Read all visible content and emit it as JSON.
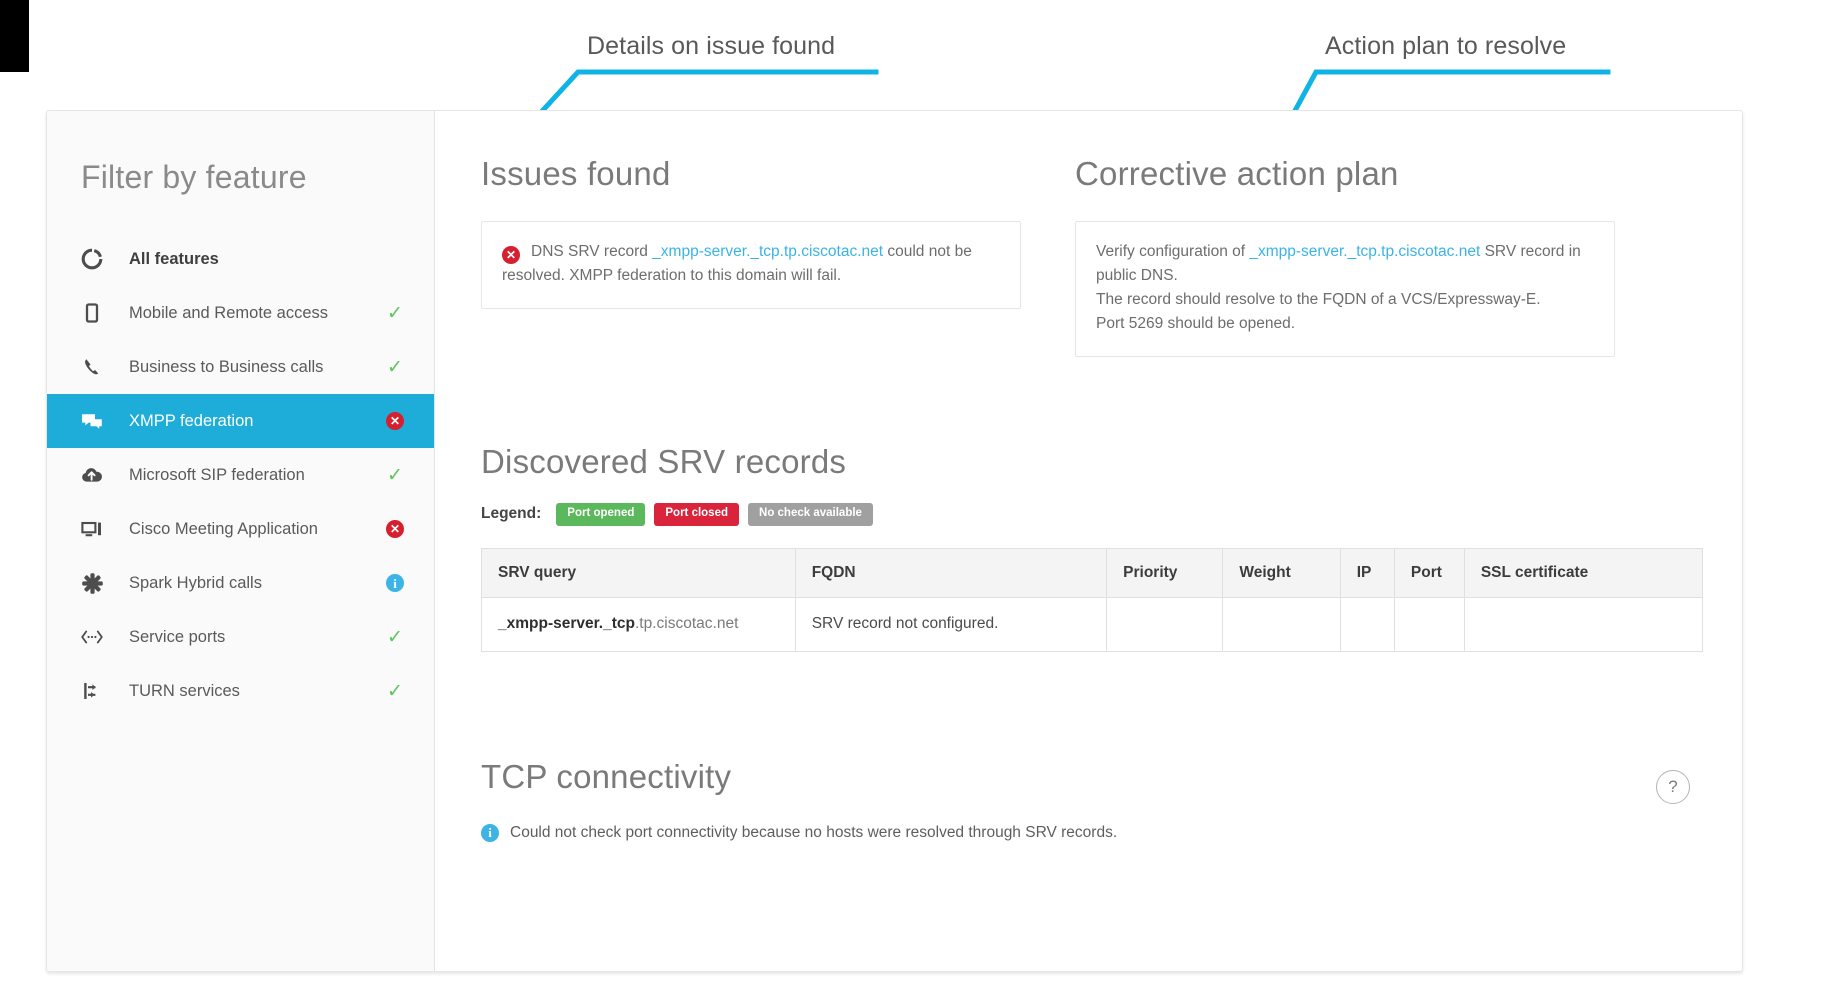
{
  "annotations": {
    "left": {
      "text": "Details on issue found"
    },
    "right": {
      "text": "Action plan to resolve"
    },
    "line_color": "#0fb4e5"
  },
  "colors": {
    "accent": "#1eadd8",
    "link": "#3bb4e5",
    "error": "#d6202f",
    "error_text": "#e8515f",
    "success": "#5ec45e",
    "info": "#3db4e5",
    "legend_green": "#5cb85c",
    "legend_red": "#d9243c",
    "legend_gray": "#a0a0a0"
  },
  "sidebar": {
    "title": "Filter by feature",
    "items": [
      {
        "label": "All features",
        "icon": "all-features-icon",
        "status": "none",
        "bold": true,
        "active": false
      },
      {
        "label": "Mobile and Remote access",
        "icon": "mobile-device-icon",
        "status": "check",
        "bold": false,
        "active": false
      },
      {
        "label": "Business to Business calls",
        "icon": "phone-handset-icon",
        "status": "check",
        "bold": false,
        "active": false
      },
      {
        "label": "XMPP federation",
        "icon": "chat-bubbles-icon",
        "status": "error",
        "bold": false,
        "active": true
      },
      {
        "label": "Microsoft SIP federation",
        "icon": "cloud-upload-icon",
        "status": "check",
        "bold": false,
        "active": false
      },
      {
        "label": "Cisco Meeting Application",
        "icon": "monitor-icon",
        "status": "error",
        "bold": false,
        "active": false
      },
      {
        "label": "Spark Hybrid calls",
        "icon": "spark-asterisk-icon",
        "status": "info",
        "bold": false,
        "active": false
      },
      {
        "label": "Service ports",
        "icon": "service-ports-icon",
        "status": "check",
        "bold": false,
        "active": false
      },
      {
        "label": "TURN services",
        "icon": "turn-services-icon",
        "status": "check",
        "bold": false,
        "active": false
      }
    ],
    "status_glyphs": {
      "check": "✓",
      "error": "✕",
      "info": "i"
    }
  },
  "issues": {
    "heading": "Issues found",
    "item": {
      "icon": "error-badge-icon",
      "text_before": "DNS SRV record ",
      "link": "_xmpp-server._tcp.tp.ciscotac.net",
      "text_after": " could not be resolved. XMPP federation to this domain will fail."
    }
  },
  "corrective": {
    "heading": "Corrective action plan",
    "text_before": "Verify configuration of ",
    "link": "_xmpp-server._tcp.tp.ciscotac.net",
    "text_after": " SRV record in public DNS.",
    "line2": "The record should resolve to the FQDN of a VCS/Expressway-E.",
    "line3": "Port 5269 should be opened."
  },
  "srv": {
    "heading": "Discovered SRV records",
    "legend_label": "Legend:",
    "legend": [
      {
        "label": "Port opened",
        "variant": "green"
      },
      {
        "label": "Port closed",
        "variant": "red"
      },
      {
        "label": "No check available",
        "variant": "gray"
      }
    ],
    "columns": [
      "SRV query",
      "FQDN",
      "Priority",
      "Weight",
      "IP",
      "Port",
      "SSL certificate"
    ],
    "rows": [
      {
        "query_bold": "_xmpp-server._tcp",
        "query_dim": ".tp.ciscotac.net",
        "fqdn": "SRV record not configured.",
        "priority": "",
        "weight": "",
        "ip": "",
        "port": "",
        "ssl": ""
      }
    ]
  },
  "tcp": {
    "heading": "TCP connectivity",
    "note": "Could not check port connectivity because no hosts were resolved through SRV records.",
    "note_icon": "info-badge-icon",
    "help_label": "?"
  }
}
